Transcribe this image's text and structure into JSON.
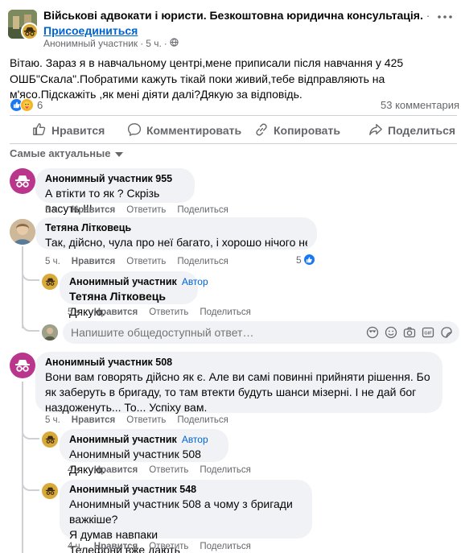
{
  "post": {
    "group_name": "Військові адвокати і юристи. Безкоштовна юридична консультація.",
    "group_name_suffix": "·",
    "join_label": "Присоединиться",
    "author": "Анонимный участник",
    "time": "5 ч.",
    "dot": "·",
    "text": "Вітаю. Зараз я в навчальному центрі,мене приписали після навчання у 425 ОШБ\"Скала\".Побратими кажуть тікай поки живий,тебе відправляють на м'ясо.Підскажіть ,як мені діяти далі?Дякую за відповідь.",
    "reaction_count": "6",
    "comments_count": "53 комментария",
    "reaction_icons": [
      "like-icon",
      "care-icon"
    ]
  },
  "actions": {
    "like": "Нравится",
    "comment": "Комментировать",
    "copy": "Копировать",
    "share": "Поделиться"
  },
  "sort_label": "Самые актуальные",
  "comments": [
    {
      "name": "Анонимный участник 955",
      "text": "А втікти то як ? Скрізь пасуть !!!",
      "time": "5 ч.",
      "like": "Нравится",
      "reply": "Ответить",
      "share": "Поделиться"
    },
    {
      "name": "Тетяна Літковець",
      "text": "Так, дійсно, чула про неї багато, і хорошо нічого не має....",
      "time": "5 ч.",
      "like": "Нравится",
      "reply": "Ответить",
      "share": "Поделиться",
      "likes": "5"
    },
    {
      "name": "Анонимный участник",
      "author_badge": "Автор",
      "mention": "Тетяна Літковець",
      "text": " Дякую.",
      "time": "5 ч.",
      "like": "Нравится",
      "reply": "Ответить",
      "share": "Поделиться"
    },
    {
      "name": "Анонимный участник 508",
      "text": "Вони вам говорять дійсно як є. Але ви самі повинні прийняти рішення. Бо як заберуть в бригаду, то там втекти будуть шанси мізерні. І не дай бог наздоженуть... То... Успіху вам.",
      "time": "5 ч.",
      "like": "Нравится",
      "reply": "Ответить",
      "share": "Поделиться"
    },
    {
      "name": "Анонимный участник",
      "author_badge": "Автор",
      "text": "Анонимный участник 508 Дякую.",
      "time": "4 ч.",
      "like": "Нравится",
      "reply": "Ответить",
      "share": "Поделиться"
    },
    {
      "name": "Анонимный участник 548",
      "text_lines": [
        "Анонимный участник 508 а чому з бригади важкіше?",
        "Я думав навпаки",
        "Телефони вже дають"
      ],
      "time": "4 ч.",
      "like": "Нравится",
      "reply": "Ответить",
      "share": "Поделиться"
    }
  ],
  "reply_placeholder": "Напишите общедоступный ответ…",
  "colors": {
    "link_blue": "#0064d1",
    "muted": "#65676b",
    "bubble": "#f0f2f5",
    "anon_pink": "#b9368c",
    "anon_gold": "#d9a93a"
  }
}
